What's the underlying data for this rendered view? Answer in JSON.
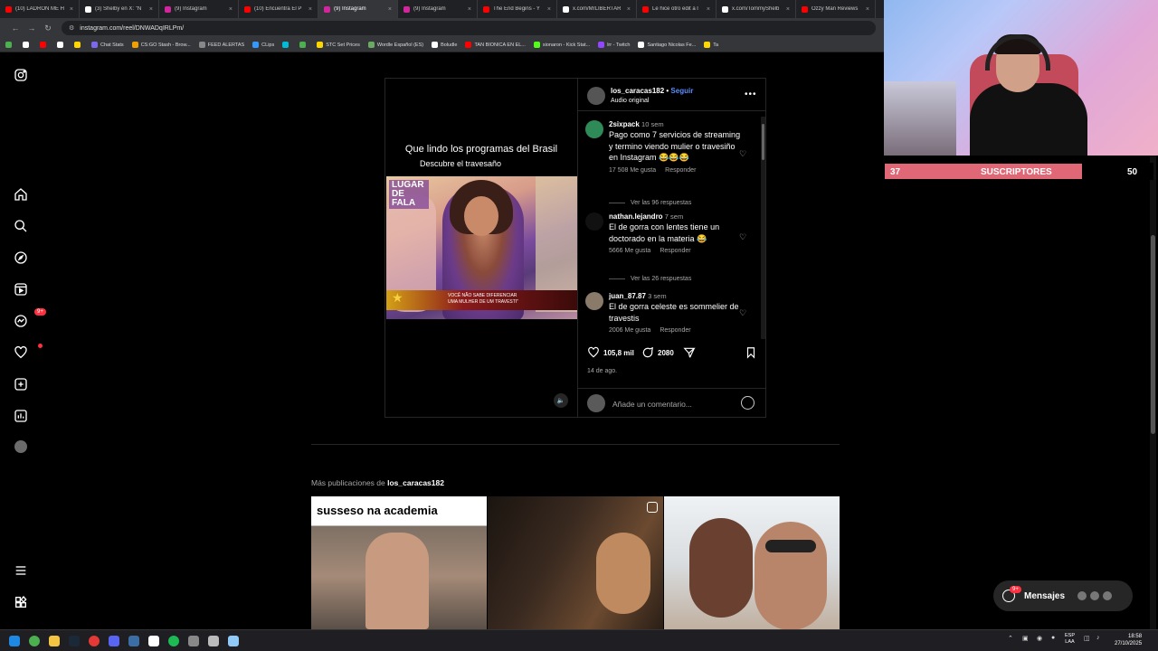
{
  "browser": {
    "tabs": [
      {
        "label": "(10) LADRÓN ME H",
        "color": "#ff0000"
      },
      {
        "label": "(3) Shelby en X: \"N",
        "color": "#ffffff"
      },
      {
        "label": "(9) Instagram",
        "color": "#d6249f"
      },
      {
        "label": "(10) Encuentra El P",
        "color": "#ff0000"
      },
      {
        "label": "(9) Instagram",
        "color": "#d6249f",
        "active": true
      },
      {
        "label": "(9) Instagram",
        "color": "#d6249f"
      },
      {
        "label": "The End Begins - Y",
        "color": "#ff0000"
      },
      {
        "label": "x.com/MrLIBERTAR",
        "color": "#ffffff"
      },
      {
        "label": "Le hice otro edit a l",
        "color": "#ff0000"
      },
      {
        "label": "x.com/TommyShelb",
        "color": "#ffffff"
      },
      {
        "label": "Ozzy Man Reviews",
        "color": "#ff0000"
      }
    ],
    "url": "instagram.com/reel/DNWADqIRLPm/",
    "bookmarks": [
      {
        "label": "",
        "color": "#4caf50"
      },
      {
        "label": "",
        "color": "#ffffff"
      },
      {
        "label": "",
        "color": "#ff0000"
      },
      {
        "label": "",
        "color": "#ffffff"
      },
      {
        "label": "",
        "color": "#ffd700"
      },
      {
        "label": "Chat Stats",
        "color": "#7b68ee"
      },
      {
        "label": "CS:GO Stash - Brow...",
        "color": "#f0a000"
      },
      {
        "label": "FEED ALERTAS",
        "color": "#888888"
      },
      {
        "label": "CLips",
        "color": "#3399ff"
      },
      {
        "label": "",
        "color": "#00bcd4"
      },
      {
        "label": "",
        "color": "#4caf50"
      },
      {
        "label": "STC Set Prices",
        "color": "#ffd700"
      },
      {
        "label": "Wordle Español (ES)",
        "color": "#6aaa64"
      },
      {
        "label": "Boludle",
        "color": "#ffffff"
      },
      {
        "label": "TAN BIONICA EN EL...",
        "color": "#ff0000"
      },
      {
        "label": "sionaron - Kick Stat...",
        "color": "#53fc18"
      },
      {
        "label": "lrr - Twitch",
        "color": "#9146ff"
      },
      {
        "label": "Santiago Nicolas Fe...",
        "color": "#ffffff"
      },
      {
        "label": "Ta",
        "color": "#ffd700"
      }
    ]
  },
  "post": {
    "username": "los_caracas182",
    "separator": " • ",
    "follow": "Seguir",
    "audio": "Audio original",
    "media_title": "Que lindo los programas del Brasil",
    "media_caption": "Descubre el travesaño",
    "media_logo": "LUGAR DE FALA",
    "lower_third_line1": "VOCÊ NÃO SABE DIFERENCIAR",
    "lower_third_line2": "UMA MULHER DE UM TRAVESTI\"",
    "comments": [
      {
        "user": "2sixpack",
        "time": "10 sem",
        "text": "Pago como 7 servicios de streaming y termino viendo mulier o travesiño en Instagram 😂😂😂",
        "likes": "17 508 Me gusta",
        "reply": "Responder",
        "replies": "Ver las 96 respuestas",
        "avatar_color": "#2e8b57"
      },
      {
        "user": "nathan.lejandro",
        "time": "7 sem",
        "text": "El de gorra con lentes tiene un doctorado en la materia 😂",
        "likes": "5666 Me gusta",
        "reply": "Responder",
        "replies": "Ver las 26 respuestas",
        "avatar_color": "#111111"
      },
      {
        "user": "juan_87.87",
        "time": "3 sem",
        "text": "El de gorra celeste es sommelier de travestis",
        "likes": "2006 Me gusta",
        "reply": "Responder",
        "avatar_color": "#8a7a6a"
      }
    ],
    "like_count": "105,8 mil",
    "comment_count": "2080",
    "date": "14 de ago.",
    "comment_placeholder": "Añade un comentario..."
  },
  "more": {
    "prefix": "Más publicaciones de ",
    "user": "los_caracas182",
    "thumb1_text": "susseso  na academia"
  },
  "messages": {
    "label": "Mensajes",
    "badge": "9+"
  },
  "nav": {
    "notifications_badge": "9+"
  },
  "stream_overlay": {
    "subs_current": "37",
    "subs_label": "SUSCRIPTORES",
    "subs_goal": "50",
    "fill_fraction": 0.74
  },
  "taskbar": {
    "lang1": "ESP",
    "lang2": "LAA",
    "time": "18:58",
    "date": "27/10/2025"
  }
}
